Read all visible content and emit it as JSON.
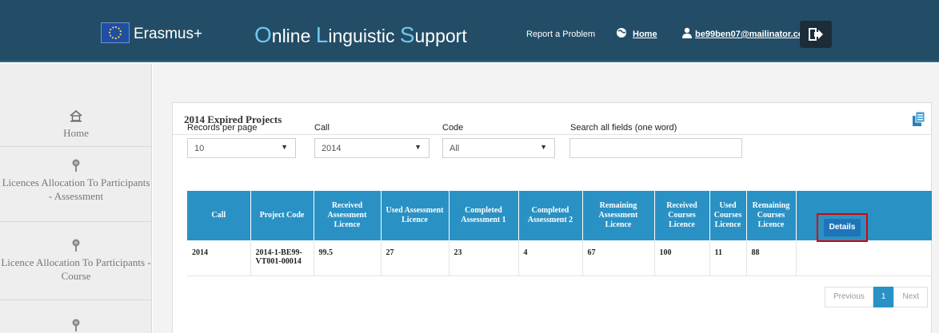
{
  "header": {
    "brand": "Erasmus+",
    "title_parts": [
      {
        "big": "O",
        "rest": "nline "
      },
      {
        "big": "L",
        "rest": "inguistic "
      },
      {
        "big": "S",
        "rest": "upport"
      }
    ],
    "report_link": "Report a Problem",
    "home_link": "Home",
    "user_email": "be99ben07@mailinator.com",
    "icons": {
      "flag": "eu-flag-icon",
      "home": "globe-home-icon",
      "user": "user-icon",
      "logout": "logout-icon"
    }
  },
  "sidebar": {
    "items": [
      {
        "label": "Home",
        "icon": "home-icon"
      },
      {
        "label": "Licences Allocation To Participants - Assessment",
        "icon": "award-icon"
      },
      {
        "label": "Licence Allocation To Participants - Course",
        "icon": "award-icon"
      },
      {
        "label": "",
        "icon": "award-icon"
      }
    ]
  },
  "panel": {
    "title": "2014 Expired Projects",
    "export_icon": "export-icon"
  },
  "filters": {
    "records_label": "Records per page",
    "records_value": "10",
    "call_label": "Call",
    "call_value": "2014",
    "code_label": "Code",
    "code_value": "All",
    "search_label": "Search all fields (one word)",
    "search_value": ""
  },
  "table": {
    "headers": [
      "Call",
      "Project Code",
      "Received Assessment Licence",
      "Used Assessment Licence",
      "Completed Assessment 1",
      "Completed Assessment 2",
      "Remaining Assessment Licence",
      "Received Courses Licence",
      "Used Courses Licence",
      "Remaining Courses Licence",
      ""
    ],
    "rows": [
      [
        "2014",
        "2014-1-BE99-VT001-00014",
        "99.5",
        "27",
        "23",
        "4",
        "67",
        "100",
        "11",
        "88"
      ]
    ],
    "details_label": "Details"
  },
  "pagination": {
    "previous": "Previous",
    "current": "1",
    "next": "Next"
  },
  "colors": {
    "header_bg": "#234d66",
    "accent_blue": "#2a91c4",
    "highlight_red": "#e00000",
    "button_blue": "#1f74b8"
  }
}
